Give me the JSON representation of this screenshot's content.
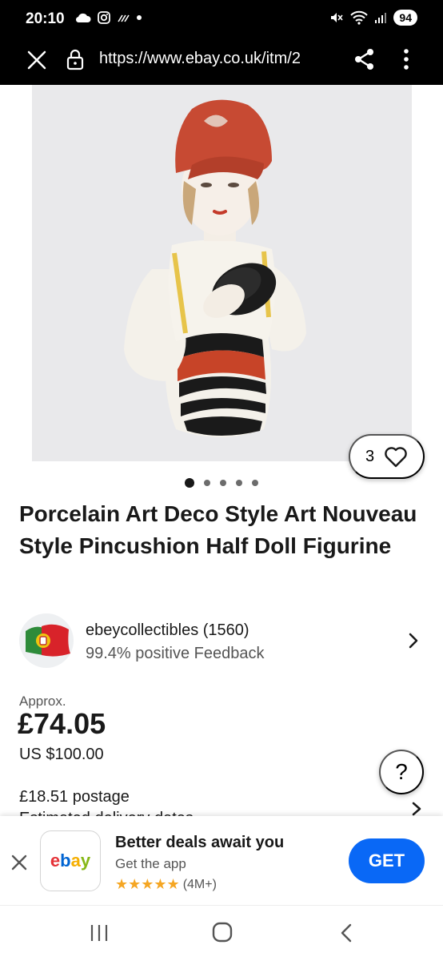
{
  "status_bar": {
    "time": "20:10",
    "battery": "94",
    "left_icons": [
      "cloud-icon",
      "instagram-icon",
      "signal-lines-icon",
      "dot-icon"
    ],
    "right_icons": [
      "mute-icon",
      "wifi-icon",
      "cell-signal-icon"
    ]
  },
  "browser": {
    "url": "https://www.ebay.co.uk/itm/2",
    "close_icon": "close-icon",
    "lock_icon": "lock-icon",
    "share_icon": "share-icon",
    "more_icon": "more-vert-icon"
  },
  "listing": {
    "watch_count": "3",
    "image_count": 5,
    "active_image": 1,
    "title": "Porcelain Art Deco Style Art Nouveau Style Pincushion Half Doll Figurine",
    "seller": {
      "name": "ebeycollectibles (1560)",
      "feedback": "99.4% positive Feedback"
    },
    "price": {
      "approx_label": "Approx.",
      "gbp": "£74.05",
      "usd": "US $100.00"
    },
    "postage": "£18.51 postage",
    "cutoff_line": "Estimated delivery dates"
  },
  "help_button": "?",
  "app_banner": {
    "logo_text": "ebay",
    "headline": "Better deals await you",
    "subtitle": "Get the app",
    "stars": "★★★★★",
    "rating_count": "(4M+)",
    "cta": "GET"
  },
  "colors": {
    "get_button": "#0968f6",
    "star": "#f5a623",
    "ebay_e": "#e53238",
    "ebay_b": "#0064d2",
    "ebay_a": "#f5af02",
    "ebay_y": "#86b817"
  }
}
